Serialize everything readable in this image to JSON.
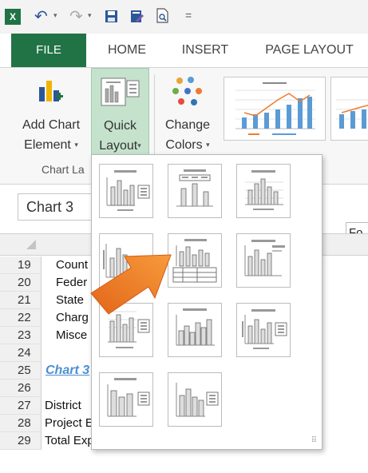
{
  "app": {
    "logo": "X"
  },
  "qat": {
    "undo_icon": "undo-icon",
    "redo_icon": "redo-icon",
    "save_icon": "save-icon",
    "caret": "▾",
    "customize": "="
  },
  "tabs": {
    "file": "FILE",
    "home": "HOME",
    "insert": "INSERT",
    "page_layout": "PAGE LAYOUT"
  },
  "ribbon": {
    "add_chart_element": {
      "line1": "Add Chart",
      "line2": "Element"
    },
    "quick_layout": {
      "line1": "Quick",
      "line2": "Layout"
    },
    "change_colors": {
      "line1": "Change",
      "line2": "Colors"
    },
    "group_label": "Chart La",
    "caret": "▾",
    "accent": "#217346",
    "highlight": "#c5e2cd"
  },
  "namebox": {
    "value": "Chart 3"
  },
  "formula_fragment": "Fo",
  "sheet": {
    "rows": [
      {
        "num": "19",
        "text": "Count",
        "style": "indent"
      },
      {
        "num": "20",
        "text": "Feder",
        "style": "indent"
      },
      {
        "num": "21",
        "text": "State",
        "style": "indent"
      },
      {
        "num": "22",
        "text": "Charg",
        "style": "indent"
      },
      {
        "num": "23",
        "text": "Misce",
        "style": "indent"
      },
      {
        "num": "24",
        "text": "",
        "style": ""
      },
      {
        "num": "25",
        "text": "Chart 3",
        "style": "link"
      },
      {
        "num": "26",
        "text": "",
        "style": ""
      },
      {
        "num": "27",
        "text": "District",
        "style": ""
      },
      {
        "num": "28",
        "text": "Project Expenditures",
        "style": ""
      },
      {
        "num": "29",
        "text": "Total Expenditures",
        "style": ""
      }
    ]
  },
  "gallery": {
    "layouts": [
      "Layout 1",
      "Layout 2",
      "Layout 3",
      "Layout 4",
      "Layout 5",
      "Layout 6",
      "Layout 7",
      "Layout 8",
      "Layout 9",
      "Layout 10",
      "Layout 11"
    ]
  },
  "arrow_color": "#f07c24"
}
